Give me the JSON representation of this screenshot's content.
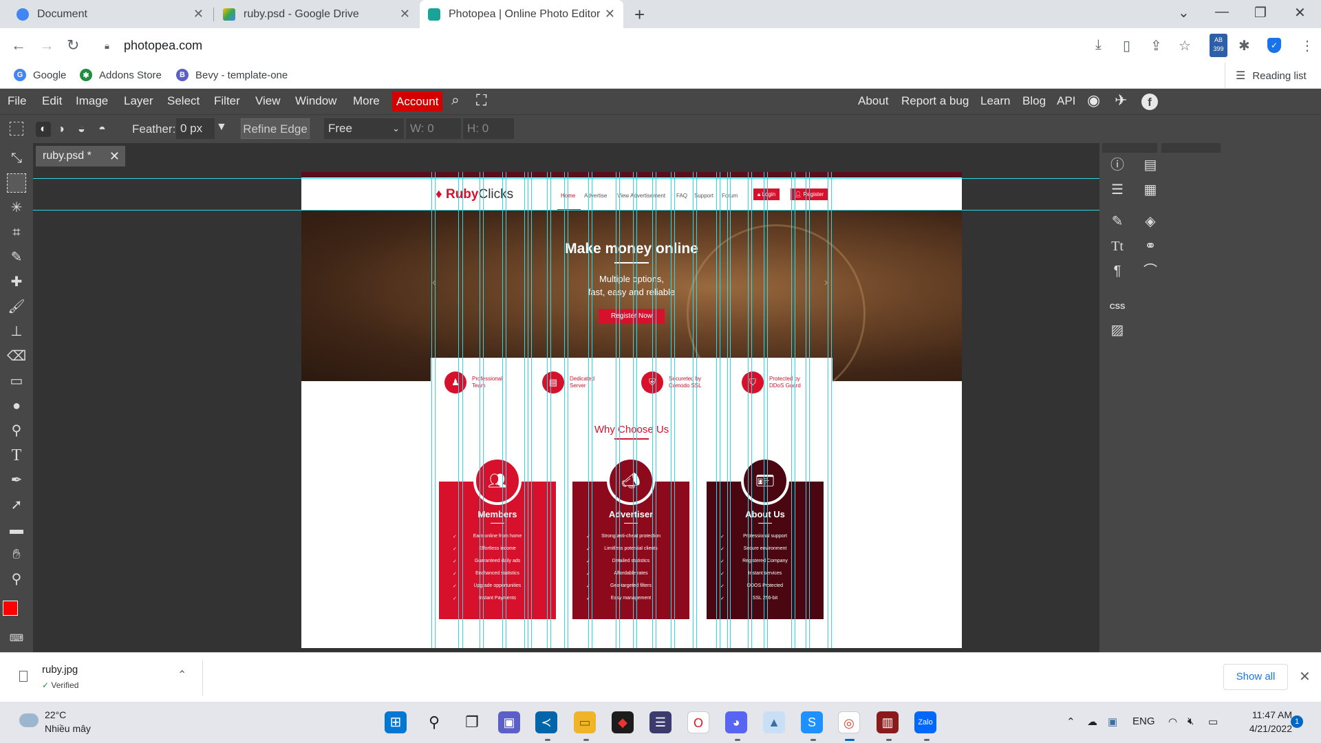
{
  "browser": {
    "tabs": [
      {
        "title": "Document",
        "color": "#4285f4"
      },
      {
        "title": "ruby.psd - Google Drive",
        "color": "#34a853"
      },
      {
        "title": "Photopea | Online Photo Editor",
        "color": "#18a497"
      }
    ],
    "url": "photopea.com",
    "bookmarks": [
      {
        "label": "Google",
        "color": "#4285f4"
      },
      {
        "label": "Addons Store",
        "color": "#1e8e3e"
      },
      {
        "label": "Bevy - template-one",
        "color": "#5b5fc7"
      }
    ],
    "reading_list": "Reading list",
    "extension_badge": "399",
    "badge_ab": "AB"
  },
  "photopea": {
    "menu": [
      "File",
      "Edit",
      "Image",
      "Layer",
      "Select",
      "Filter",
      "View",
      "Window",
      "More"
    ],
    "account": "Account",
    "right_menu": [
      "About",
      "Report a bug",
      "Learn",
      "Blog",
      "API"
    ],
    "options": {
      "feather_label": "Feather:",
      "feather_value": "0 px",
      "refine_edge": "Refine Edge",
      "style_value": "Free",
      "w_label": "W:",
      "w_value": "0",
      "h_label": "H:",
      "h_value": "0"
    },
    "document_tab": "ruby.psd *",
    "panel_css_label": "CSS",
    "colors": {
      "foreground": "#ff0000",
      "background": "#000000",
      "accent": "#d40000"
    }
  },
  "site": {
    "logo_bold": "Ruby",
    "logo_rest": "Clicks",
    "nav": [
      "Home",
      "Advertise",
      "View Advertisement",
      "FAQ",
      "Support",
      "Forum"
    ],
    "login": "Login",
    "register": "Register",
    "hero_title": "Make money online",
    "hero_sub1": "Multiple options,",
    "hero_sub2": "fast, easy and reliable",
    "hero_cta": "Register Now",
    "features": [
      {
        "line1": "Professional",
        "line2": "Team"
      },
      {
        "line1": "Dedicated",
        "line2": "Server"
      },
      {
        "line1": "Secureted by",
        "line2": "Comodo SSL"
      },
      {
        "line1": "Protected by",
        "line2": "DDoS Guard"
      }
    ],
    "why_title": "Why Choose Us",
    "cards": [
      {
        "title": "Members",
        "color": "#d7102b",
        "items": [
          "Earn online from home",
          "Effortless income",
          "Guaranteed daily ads",
          "Enchanced statistics",
          "Upgrade opportunities",
          "Instant Payments"
        ]
      },
      {
        "title": "Advertiser",
        "color": "#8d0a1c",
        "items": [
          "Strong anti-cheat protection",
          "Limitless potential clients",
          "Detailed statistics",
          "Affordable rates",
          "Geo-targeted filters",
          "Easy management"
        ]
      },
      {
        "title": "About Us",
        "color": "#4a0712",
        "items": [
          "Professional support",
          "Secure environment",
          "Registered Company",
          "Instant services",
          "DDOS Protected",
          "SSL 256-bit"
        ]
      }
    ]
  },
  "download": {
    "file": "ruby.jpg",
    "status": "Verified",
    "show_all": "Show all"
  },
  "taskbar": {
    "temp": "22°C",
    "condition": "Nhiều mây",
    "lang": "ENG",
    "time": "11:47 AM",
    "date": "4/21/2022",
    "notifications": "1"
  }
}
